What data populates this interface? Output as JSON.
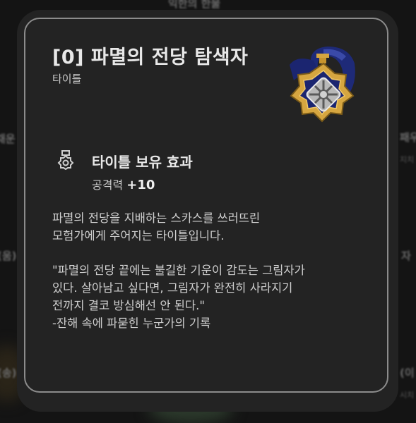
{
  "background": {
    "fragments": [
      {
        "text": "익한의 한물",
        "name": "bg-fragment-top"
      },
      {
        "text": "채운",
        "name": "bg-fragment-left-1"
      },
      {
        "text": "(움)",
        "name": "bg-fragment-left-2"
      },
      {
        "text": "(송)",
        "name": "bg-fragment-left-3"
      },
      {
        "text": "패우",
        "name": "bg-fragment-right-1"
      },
      {
        "text": "지치",
        "name": "bg-fragment-right-1-sub"
      },
      {
        "text": "자",
        "name": "bg-fragment-right-2"
      },
      {
        "text": "(이",
        "name": "bg-fragment-right-3"
      },
      {
        "text": "시치",
        "name": "bg-fragment-right-3-sub"
      }
    ]
  },
  "tooltip": {
    "title": "[0] 파멸의 전당 탐색자",
    "subtitle": "타이틀",
    "emblem_icon": "medal-emblem-icon",
    "effect": {
      "icon": "medal-outline-icon",
      "title": "타이틀 보유 효과",
      "stat_label": "공격력",
      "stat_value": "+10"
    },
    "description": [
      "파멸의 전당을 지배하는 스카스를 쓰러뜨린",
      "모험가에게 주어지는 타이틀입니다."
    ],
    "lore": [
      "\"파멸의 전당 끝에는 불길한 기운이 감도는 그림자가",
      "있다. 살아남고 싶다면, 그림자가 완전히 사라지기",
      "전까지 결코 방심해선 안 된다.\"",
      "-잔해 속에 파묻힌 누군가의 기록"
    ],
    "colors": {
      "panel": "#232323",
      "border": "#8c8c8c",
      "gold": "#d6a640",
      "navy": "#1e2a78"
    }
  }
}
